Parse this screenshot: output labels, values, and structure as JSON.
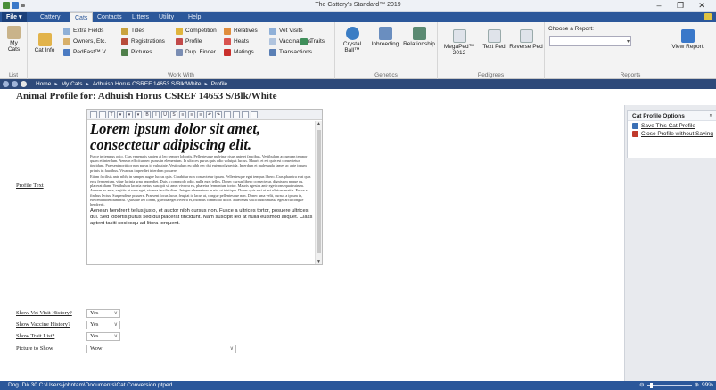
{
  "window": {
    "title": "The Cattery's Standard™ 2019"
  },
  "tabs": [
    "Cattery",
    "Cats",
    "Contacts",
    "Litters",
    "Utility",
    "Help"
  ],
  "active_tab": "Cats",
  "file_tab": "File",
  "ribbon": {
    "list": {
      "label_top": "My",
      "label_bottom": "Cats",
      "group": "List"
    },
    "cat_info": "Cat Info",
    "extra_fields": "Extra Fields",
    "owners": "Owners, Etc.",
    "pedfast": "PedFast™ V",
    "titles": "Titles",
    "registrations": "Registrations",
    "pictures": "Pictures",
    "competition": "Competition",
    "profile": "Profile",
    "dup_finder": "Dup. Finder",
    "relatives": "Relatives",
    "heats": "Heats",
    "matings": "Matings",
    "vet_visits": "Vet Visits",
    "vaccinations": "Vaccinations",
    "transactions": "Transactions",
    "traits": "Traits",
    "work_group": "Work With",
    "crystal_ball": "Crystal Ball™",
    "inbreeding": "Inbreeding",
    "relationship": "Relationship",
    "genetics_group": "Genetics",
    "megaped": "MegaPed™ 2012",
    "text_ped": "Text Ped",
    "reverse_ped": "Reverse Ped",
    "pedigrees_group": "Pedigrees",
    "choose_report": "Choose a Report:",
    "view_report": "View Report",
    "reports_group": "Reports"
  },
  "breadcrumb": [
    "Home",
    "My Cats",
    "Adhuish Horus CSREF 14653 S/Blk/White",
    "Profile"
  ],
  "page_title": "Animal Profile for: Adhuish Horus CSREF 14653 S/Blk/White",
  "profile_text": {
    "label": "Profile Text",
    "heading": "Lorem ipsum dolor sit amet, consectetur adipiscing elit.",
    "para1": "Fusce in tempus odio. Cras venenatis sapien at leo semper lobortis. Pellentesque pulvinar risus ante et faucibus. Vestibulum accumsan tempor quam et interdum. Aenean efficitur nec purus in elementum. In ultrices purus quis odio volutpat luctus. Mauris et est quis est consectetur tincidunt. Praesent porttitor non purus id vulputate. Vestibulum eu nibh nec dui euismod gravida. Interdum et malesuada fames ac ante ipsum primis in faucibus. Vivamus imperdiet interdum posuere.",
    "para2": "Etiam facilisis ante nibh, in semper augue luctus quis. Curabitur non consectetur ipsum. Pellentesque eget tempus libero. Cras pharetra erat quis eros fermentum, vitae lacinia urna imperdiet. Duis a commodo odio, nulla eget tellus. Donec cursus libero consectetur, dignissim neque eu, placerat diam. Vestibulum lacinia metus, suscipit sit amet viverra ex, pharetra fermentum tortor. Mauris egestas ante eget consequat rutrum. Aenean ex ante, sagittis ut uma eget, viverra iaculis diam. Integer elementum in nisl ut tristique. Donec quis nisi ut est ultrices mattis. Fusce a finibus lectus. Suspendisse posuere. Praesent locus lacus, feugiat id lacus at, congue pellentesque non. Donec uma velit, cursus a ipsum in, eleifend bibendum nisi. Quisque leo lorem, gravida eget viverra et, rhoncus commodo dolor. Maecenas sollicitudin massa eget arcu congue hendrerit.",
    "para3": "Aenean hendrerit tellus justo, et auctor nibh cursus non. Fusce a ultrices tortor, posuere ultrices dui. Sed lobortis purus sed dui placerat tincidunt. Nam suscipit leo at nulla euismod aliquet. Class aptent taciti sociosqu ad litora torquent."
  },
  "fields": {
    "vet_label": "Show Vet Visit History?",
    "vet_value": "Yes",
    "vaccine_label": "Show Vaccine History?",
    "vaccine_value": "Yes",
    "trait_label": "Show Trait List?",
    "trait_value": "Yes",
    "picture_label": "Picture to Show",
    "picture_value": "Wow"
  },
  "options_panel": {
    "title": "Cat Profile Options",
    "save": "Save This Cat Profile",
    "close": "Close Profile without Saving"
  },
  "statusbar": {
    "text": "Dog ID# 30   C:\\Users\\johntam\\Documents\\Cat Conversion.ptped",
    "zoom": "99%"
  },
  "colors": {
    "ribbon_blue": "#2b579a",
    "nav_blue": "#2e4a7a"
  }
}
